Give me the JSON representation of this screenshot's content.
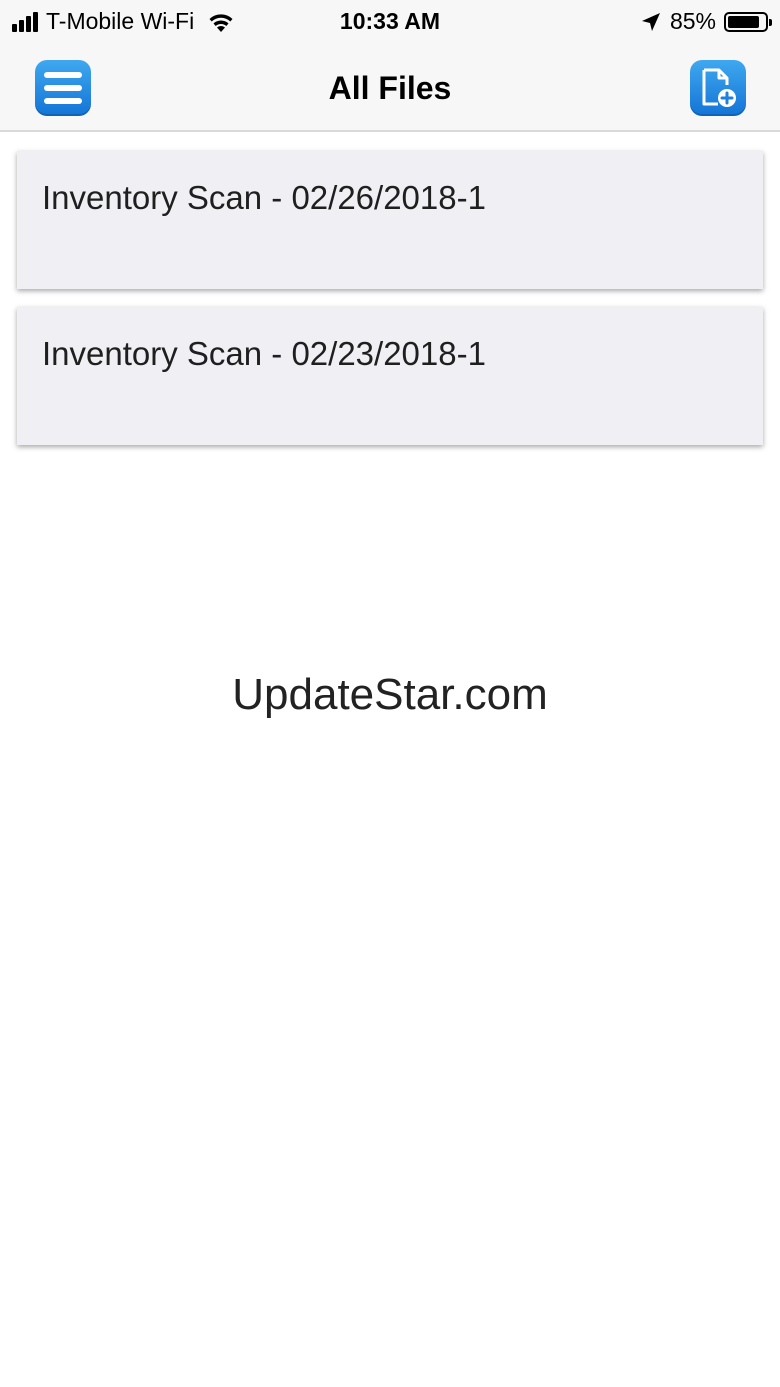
{
  "status_bar": {
    "carrier": "T-Mobile Wi-Fi",
    "time": "10:33 AM",
    "battery_percent": "85%",
    "battery_level": 0.85,
    "icons": [
      "signal-icon",
      "wifi-icon",
      "location-arrow-icon",
      "battery-icon"
    ]
  },
  "nav_bar": {
    "title": "All Files",
    "left_icon": "menu-icon",
    "right_icon": "new-file-icon",
    "accent_color": "#1E88E5"
  },
  "files": [
    {
      "name": "Inventory Scan - 02/26/2018-1"
    },
    {
      "name": "Inventory Scan - 02/23/2018-1"
    }
  ],
  "watermark": "UpdateStar.com"
}
